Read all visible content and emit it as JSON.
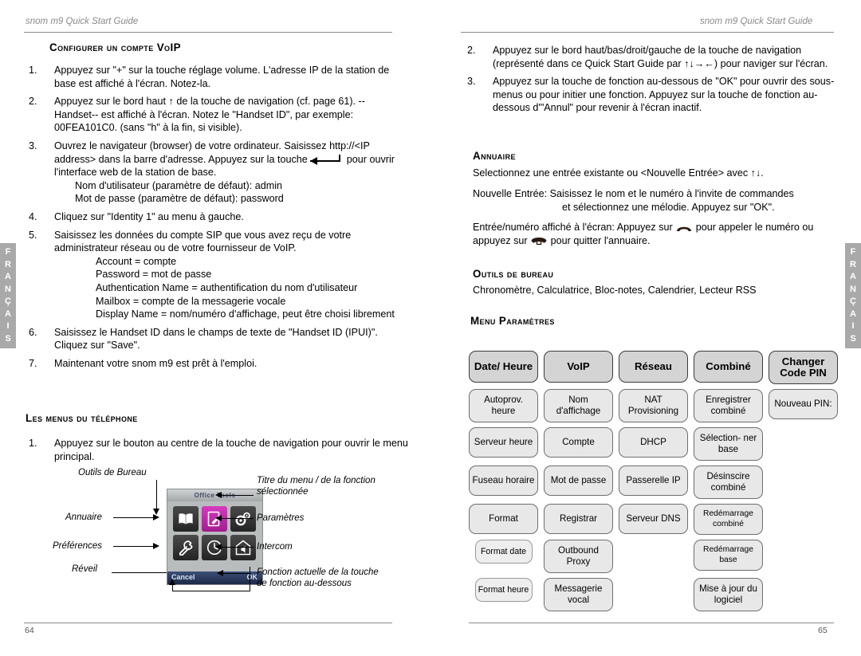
{
  "running_head": "snom m9 Quick Start Guide",
  "left_page_number": "64",
  "right_page_number": "65",
  "lang_tab": [
    "F",
    "R",
    "A",
    "N",
    "Ç",
    "A",
    "I",
    "S"
  ],
  "left_column": {
    "heading_voip": "Configurer un compte VoIP",
    "steps": [
      {
        "num": "1.",
        "text": "Appuyez sur \"+\" sur la touche réglage volume. L'adresse IP de la station de base est affiché à l'écran.  Notez-la."
      },
      {
        "num": "2.",
        "text": "Appuyez sur le bord haut ↑ de la touche de navigation (cf. page 61). --Handset-- est affiché à l'écran. Notez le \"Handset ID\", par exemple: 00FEA101C0. (sans \"h\" à la fin, si visible)."
      },
      {
        "num": "3.",
        "text": "Ouvrez le navigateur (browser) de votre ordinateur. Saisissez http://<IP address> dans la barre d'adresse. Appuyez sur la touche",
        "text_after_key": "pour ouvrir l'interface web de la station de base.",
        "sub1": "Nom d'utilisateur (paramètre de défaut):  admin",
        "sub2": "Mot de passe (paramètre de défaut):   password"
      },
      {
        "num": "4.",
        "text": "Cliquez sur \"Identity 1\" au menu à gauche."
      },
      {
        "num": "5.",
        "text": "Saisissez les données du compte SIP que vous avez reçu de votre administrateur réseau ou de votre fournisseur de VoIP.",
        "sublines": [
          "Account = compte",
          "Password = mot de passe",
          "Authentication Name = authentification du nom d'utilisateur",
          "Mailbox = compte de la messagerie vocale",
          "Display Name = nom/numéro d'affichage, peut être choisi librement"
        ]
      },
      {
        "num": "6.",
        "text": "Saisissez le Handset ID dans le champs de texte de \"Handset ID (IPUI)\". Cliquez sur \"Save\"."
      },
      {
        "num": "7.",
        "text": "Maintenant votre snom m9 est prêt à l'emploi."
      }
    ],
    "heading_menus": "Les menus du téléphone",
    "menus_step": {
      "num": "1.",
      "text": "Appuyez sur le bouton au centre de la touche de navigation pour ouvrir le menu principal."
    }
  },
  "diagram": {
    "screen_title": "Office Tools",
    "softkey_left": "Cancel",
    "softkey_right": "OK",
    "icons": [
      {
        "name": "book-icon",
        "label": "Annuaire"
      },
      {
        "name": "notepad-icon",
        "label": "Outils de Bureau",
        "selected": true
      },
      {
        "name": "gears-icon",
        "label": "Paramètres"
      },
      {
        "name": "wrench-icon",
        "label": "Préférences"
      },
      {
        "name": "clock-icon",
        "label": "Réveil"
      },
      {
        "name": "intercom-icon",
        "label": "Intercom"
      }
    ],
    "labels": {
      "top": "Outils de Bureau",
      "left_1": "Annuaire",
      "left_2": "Préférences",
      "left_3": "Réveil",
      "right_1": "Titre du menu / de la fonction sélectionnée",
      "right_2": "Paramètres",
      "right_3": "Intercom",
      "right_4": "Fonction actuelle de la touche de fonction au-dessous"
    }
  },
  "right_column": {
    "steps": [
      {
        "num": "2.",
        "text": "Appuyez sur le bord haut/bas/droit/gauche de la touche de navigation (représenté dans ce Quick Start Guide par ↑↓→←) pour naviger sur l'écran."
      },
      {
        "num": "3.",
        "text": "Appuyez sur la touche de fonction au-dessous de \"OK\" pour ouvrir des sous-menus ou pour initier une fonction. Appuyez sur la touche de fonction au-dessous d'\"Annul\" pour revenir à l'écran inactif."
      }
    ],
    "heading_annuaire": "Annuaire",
    "annuaire_p1": "Selectionnez une entrée existante ou <Nouvelle Entrée> avec ↑↓.",
    "annuaire_p2_label": "Nouvelle Entrée:",
    "annuaire_p2_line1": "Saisissez le nom et le numéro à l'invite de commandes",
    "annuaire_p2_line2": "et sélectionnez une mélodie.  Appuyez sur \"OK\".",
    "annuaire_p3_a": "Entrée/numéro affiché à l'écran:  Appuyez sur",
    "annuaire_p3_b": "pour appeler le numéro ou appuyez sur",
    "annuaire_p3_c": "pour quitter l'annuaire.",
    "heading_outils": "Outils de bureau",
    "outils_text": "Chronomètre, Calculatrice, Bloc-notes, Calendrier, Lecteur RSS",
    "heading_menu_param": "Menu Paramètres"
  },
  "menu_table": {
    "columns": [
      {
        "header": "Date/ Heure",
        "items": [
          "Autoprov. heure",
          "Serveur heure",
          "Fuseau horaire",
          "Format"
        ],
        "sub_items": [
          "Format date",
          "Format heure"
        ]
      },
      {
        "header": "VoIP",
        "items": [
          "Nom d'affichage",
          "Compte",
          "Mot de passe",
          "Registrar",
          "Outbound Proxy",
          "Messagerie vocal"
        ],
        "sub_items": []
      },
      {
        "header": "Réseau",
        "items": [
          "NAT Provisioning",
          "DHCP",
          "Passerelle IP",
          "Serveur DNS"
        ],
        "sub_items": []
      },
      {
        "header": "Combiné",
        "items": [
          "Enregistrer combiné",
          "Sélection- ner base",
          "Désinscire combiné",
          "Redémarrage combiné",
          "Redémarrage base",
          "Mise à jour du logiciel"
        ],
        "sub_items": []
      },
      {
        "header": "Changer Code PIN",
        "items": [
          "Nouveau PIN:"
        ],
        "sub_items": []
      }
    ]
  },
  "colors": {
    "rule": "#8c8c8c",
    "tab_bg": "#a9a9a9",
    "running_head": "#8a8a8a",
    "box_fill": "#e8e8e8",
    "box_head_fill": "#d4d4d4",
    "screen_selected": "#c32fae"
  }
}
